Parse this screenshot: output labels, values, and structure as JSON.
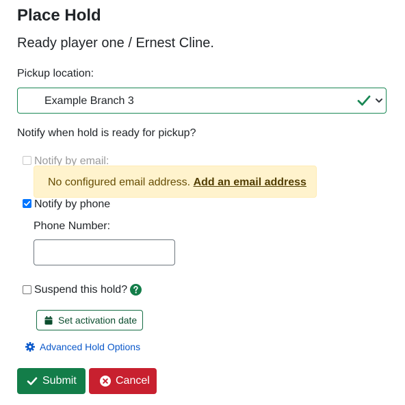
{
  "heading": "Place Hold",
  "item_title": "Ready player one / Ernest Cline.",
  "pickup": {
    "label": "Pickup location:",
    "selected": "Example Branch 3"
  },
  "notify": {
    "question": "Notify when hold is ready for pickup?",
    "email_label": "Notify by email:",
    "email_checked": false,
    "email_disabled": true,
    "email_alert_text": "No configured email address.",
    "email_alert_link": "Add an email address",
    "phone_label": "Notify by phone",
    "phone_checked": true,
    "phone_number_label": "Phone Number:",
    "phone_number_value": ""
  },
  "suspend": {
    "label": "Suspend this hold?",
    "checked": false,
    "set_activation_label": "Set activation date"
  },
  "advanced_options_label": "Advanced Hold Options",
  "buttons": {
    "submit": "Submit",
    "cancel": "Cancel"
  },
  "colors": {
    "success": "#198754",
    "danger": "#c8202f",
    "link": "#0a58ca",
    "alert_bg": "#fff3cd",
    "checkbox_checked": "#0075ff"
  },
  "icons": {
    "valid": "check-icon",
    "dropdown": "chevron-down-icon",
    "help": "question-circle-icon",
    "calendar": "calendar-icon",
    "advanced": "gear-icon",
    "submit": "check-icon",
    "cancel": "times-circle-icon"
  }
}
